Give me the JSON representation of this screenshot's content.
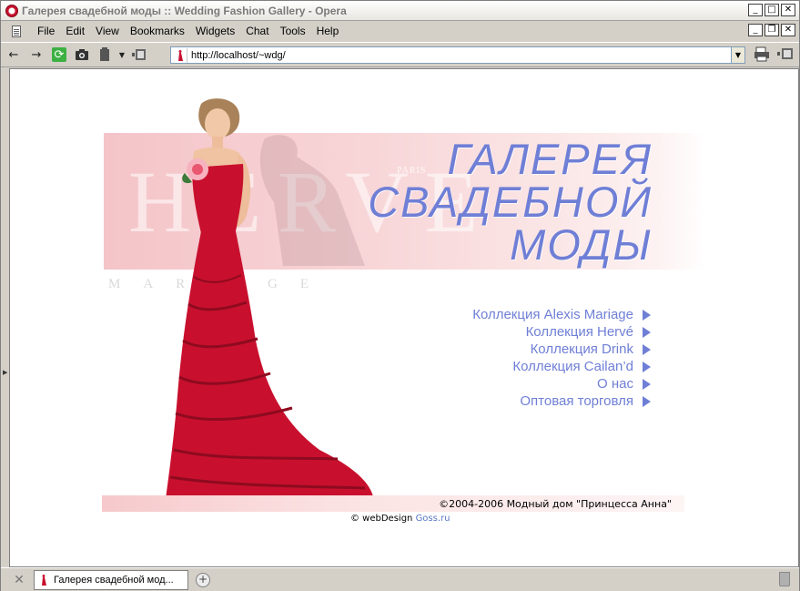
{
  "window": {
    "title": "Галерея свадебной моды :: Wedding Fashion Gallery - Opera",
    "controls": {
      "minimize": "_",
      "maximize": "□",
      "close": "✕",
      "restore": "❐"
    }
  },
  "menu": {
    "items": [
      "File",
      "Edit",
      "View",
      "Bookmarks",
      "Widgets",
      "Chat",
      "Tools",
      "Help"
    ]
  },
  "toolbar": {
    "back_icon": "←",
    "forward_icon": "→",
    "reload_icon": "⟳",
    "camera_icon": "📷",
    "address": "http://localhost/~wdg/",
    "dropdown_icon": "▼"
  },
  "page": {
    "headline": [
      "ГАЛЕРЕЯ",
      "СВАДЕБНОЙ",
      "МОДЫ"
    ],
    "watermark": "HERVE",
    "paris": "PARIS",
    "mariage": "MARIAGE",
    "nav": [
      "Коллекция Alexis Mariage",
      "Коллекция Hervé",
      "Коллекция Drink",
      "Коллекция Cailan’d",
      "О нас",
      "Оптовая торговля"
    ],
    "copyright": "©2004-2006 Модный дом \"Принцесса Анна\"",
    "credit_prefix": "© webDesign ",
    "credit_link": "Goss.ru"
  },
  "tabbar": {
    "tab_title": "Галерея свадебной мод...",
    "new_tab": "+"
  },
  "colors": {
    "accent": "#6f7fd6",
    "dress": "#c8102e",
    "banner_pink": "#f4c4c8"
  }
}
